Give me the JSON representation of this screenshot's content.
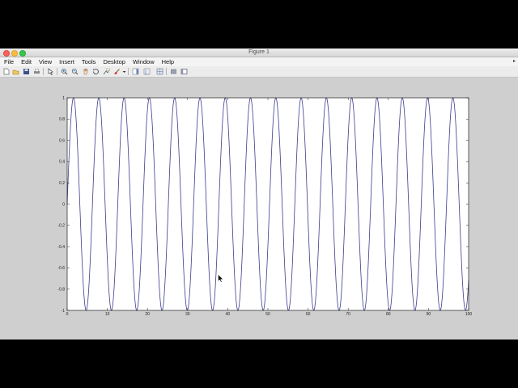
{
  "window": {
    "title": "Figure 1"
  },
  "menu": {
    "items": [
      "File",
      "Edit",
      "View",
      "Insert",
      "Tools",
      "Desktop",
      "Window",
      "Help"
    ]
  },
  "toolbar": {
    "icons": [
      "new-figure-icon",
      "open-file-icon",
      "save-icon",
      "print-icon",
      "edit-plot-icon",
      "zoom-in-icon",
      "zoom-out-icon",
      "pan-icon",
      "rotate-3d-icon",
      "data-cursor-icon",
      "brush-icon",
      "colorbar-icon",
      "legend-icon",
      "hide-plot-tools-icon",
      "show-plot-tools-icon"
    ]
  },
  "colors": {
    "line": "#3c3c8c",
    "axes_bg": "#ffffff",
    "figure_bg": "#cfcfcf"
  },
  "chart_data": {
    "type": "line",
    "function": "sine",
    "x_range": [
      0,
      100
    ],
    "y_range": [
      -1,
      1
    ],
    "period": 6.3,
    "series": [
      {
        "samples": 1000
      }
    ],
    "xticks": [
      "0",
      "10",
      "20",
      "30",
      "40",
      "50",
      "60",
      "70",
      "80",
      "90",
      "100"
    ],
    "yticks": [
      "1",
      "0.8",
      "0.6",
      "0.4",
      "0.2",
      "0",
      "-0.2",
      "-0.4",
      "-0.6",
      "-0.8",
      "-1"
    ],
    "grid": false,
    "title": "",
    "xlabel": "",
    "ylabel": ""
  }
}
